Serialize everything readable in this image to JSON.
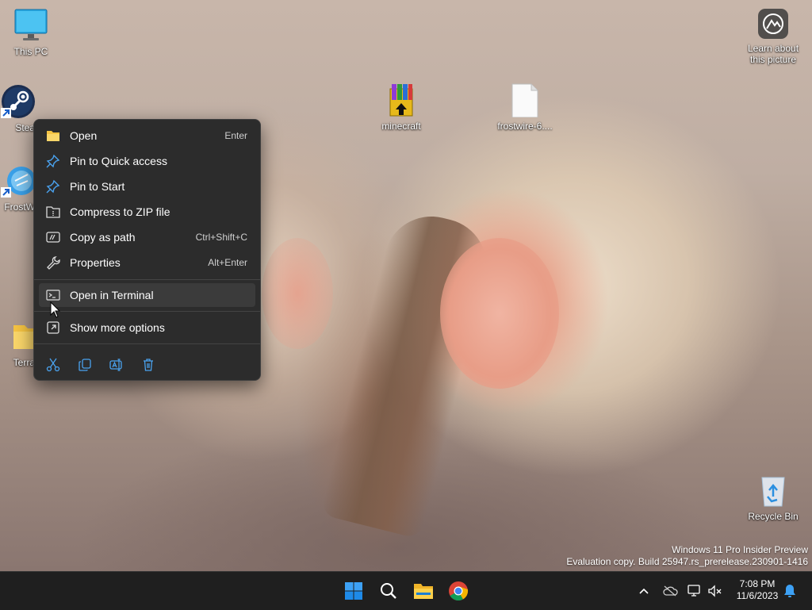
{
  "desktop": {
    "icons": {
      "this_pc": "This PC",
      "steam": "Stea",
      "frostwire_app": "FrostW",
      "terra": "Terra",
      "minecraft": "minecraft",
      "frostwire_file": "frostwire-6....",
      "recycle_bin": "Recycle Bin",
      "learn_about": "Learn about this picture"
    }
  },
  "context_menu": {
    "items": [
      {
        "label": "Open",
        "shortcut": "Enter",
        "icon": "folder-icon"
      },
      {
        "label": "Pin to Quick access",
        "shortcut": "",
        "icon": "pin-icon"
      },
      {
        "label": "Pin to Start",
        "shortcut": "",
        "icon": "pin-icon"
      },
      {
        "label": "Compress to ZIP file",
        "shortcut": "",
        "icon": "zip-icon"
      },
      {
        "label": "Copy as path",
        "shortcut": "Ctrl+Shift+C",
        "icon": "copy-path-icon"
      },
      {
        "label": "Properties",
        "shortcut": "Alt+Enter",
        "icon": "wrench-icon"
      },
      {
        "label": "Open in Terminal",
        "shortcut": "",
        "icon": "terminal-icon"
      },
      {
        "label": "Show more options",
        "shortcut": "",
        "icon": "more-options-icon"
      }
    ],
    "quick_actions": [
      "cut-icon",
      "copy-icon",
      "rename-icon",
      "delete-icon"
    ],
    "highlight_color": "#3b3b3b"
  },
  "watermark": {
    "line1": "Windows 11 Pro Insider Preview",
    "line2": "Evaluation copy. Build 25947.rs_prerelease.230901-1416"
  },
  "taskbar": {
    "apps": [
      "start-icon",
      "search-icon",
      "file-explorer-icon",
      "chrome-icon"
    ],
    "tray": [
      "chevron-up-icon",
      "onedrive-icon",
      "network-icon",
      "volume-muted-icon",
      "bell-icon"
    ],
    "time": "7:08 PM",
    "date": "11/6/2023",
    "accent": "#0078d4"
  }
}
